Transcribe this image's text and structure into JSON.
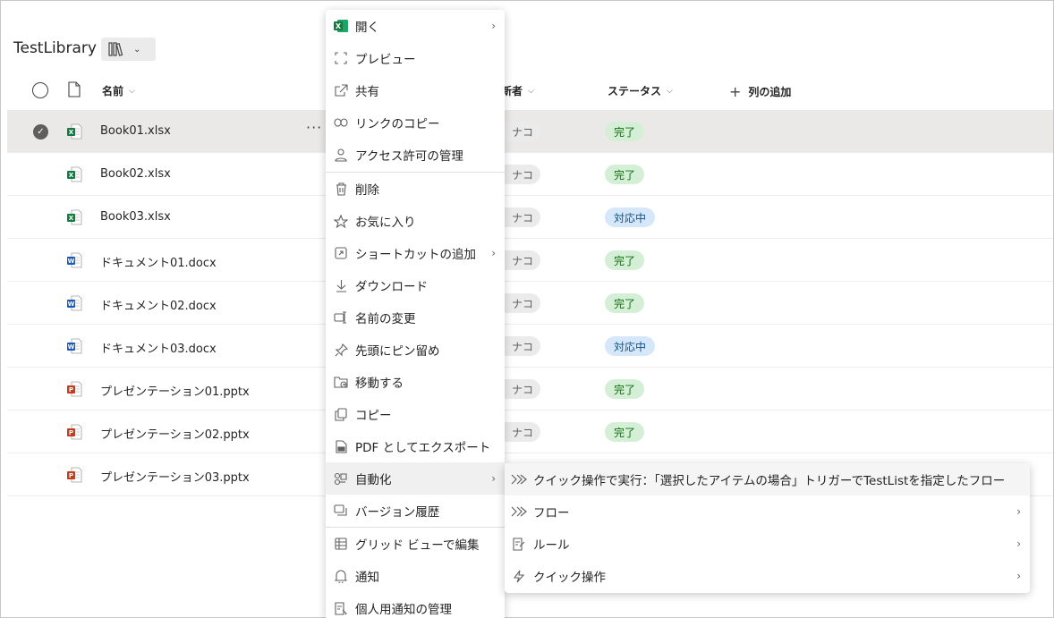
{
  "library": {
    "title": "TestLibrary"
  },
  "columns": {
    "name": "名前",
    "editor_partial": "新者",
    "status": "ステータス",
    "add_column": "列の追加"
  },
  "rows": [
    {
      "name": "Book01.xlsx",
      "type": "excel",
      "editor": "ナコ",
      "status": "完了",
      "status_kind": "done",
      "selected": true
    },
    {
      "name": "Book02.xlsx",
      "type": "excel",
      "editor": "ナコ",
      "status": "完了",
      "status_kind": "done"
    },
    {
      "name": "Book03.xlsx",
      "type": "excel",
      "editor": "ナコ",
      "status": "対応中",
      "status_kind": "progress"
    },
    {
      "name": "ドキュメント01.docx",
      "type": "word",
      "editor": "ナコ",
      "status": "完了",
      "status_kind": "done"
    },
    {
      "name": "ドキュメント02.docx",
      "type": "word",
      "editor": "ナコ",
      "status": "完了",
      "status_kind": "done"
    },
    {
      "name": "ドキュメント03.docx",
      "type": "word",
      "editor": "ナコ",
      "status": "対応中",
      "status_kind": "progress"
    },
    {
      "name": "プレゼンテーション01.pptx",
      "type": "ppt",
      "editor": "ナコ",
      "status": "完了",
      "status_kind": "done"
    },
    {
      "name": "プレゼンテーション02.pptx",
      "type": "ppt",
      "editor": "ナコ",
      "status": "完了",
      "status_kind": "done"
    },
    {
      "name": "プレゼンテーション03.pptx",
      "type": "ppt",
      "editor": "",
      "status": "",
      "status_kind": ""
    }
  ],
  "menu": {
    "open": "開く",
    "preview": "プレビュー",
    "share": "共有",
    "copy_link": "リンクのコピー",
    "manage_access": "アクセス許可の管理",
    "delete": "削除",
    "favorite": "お気に入り",
    "add_shortcut": "ショートカットの追加",
    "download": "ダウンロード",
    "rename": "名前の変更",
    "pin_top": "先頭にピン留め",
    "move": "移動する",
    "copy": "コピー",
    "export_pdf": "PDF としてエクスポート",
    "automate": "自動化",
    "version_history": "バージョン履歴",
    "grid_edit": "グリッド ビューで編集",
    "notify": "通知",
    "manage_notify": "個人用通知の管理"
  },
  "submenu": {
    "quick_run": "クイック操作で実行：「選択したアイテムの場合」トリガーでTestListを指定したフロー",
    "flow": "フロー",
    "rule": "ルール",
    "quick_action": "クイック操作"
  },
  "colors": {
    "excel": "#107c41",
    "word": "#185abd",
    "ppt": "#c43e1c",
    "done_bg": "#d4efd6",
    "progress_bg": "#d5e7f8"
  }
}
